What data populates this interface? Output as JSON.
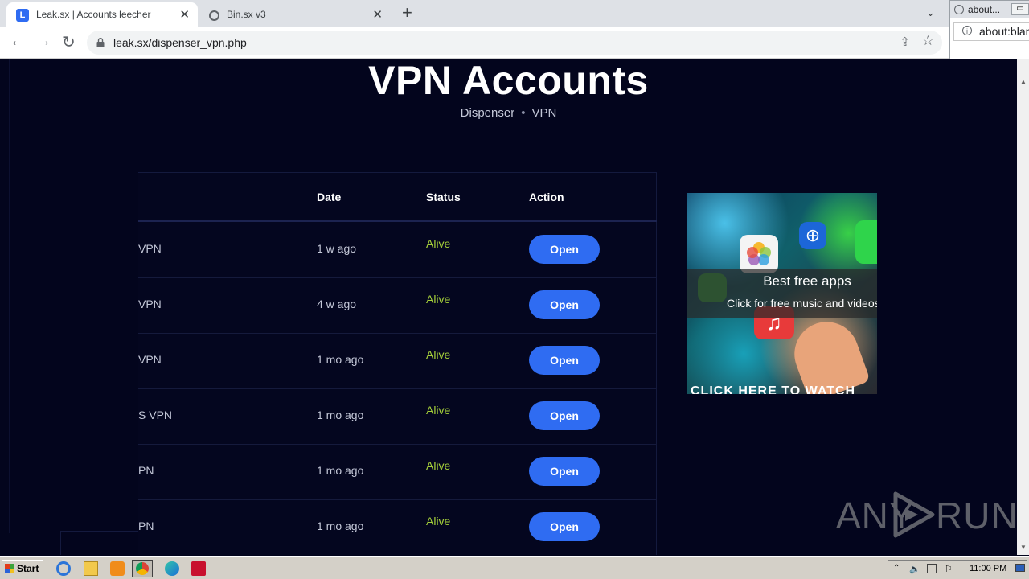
{
  "browser": {
    "tabs": [
      {
        "title": "Leak.sx | Accounts leecher",
        "active": true
      },
      {
        "title": "Bin.sx v3",
        "active": false
      }
    ],
    "url": "leak.sx/dispenser_vpn.php",
    "popup": {
      "tab_title": "about...",
      "url": "about:blank"
    }
  },
  "page": {
    "title": "VPN Accounts",
    "breadcrumb": [
      "Dispenser",
      "VPN"
    ],
    "table": {
      "headers": {
        "date": "Date",
        "status": "Status",
        "action": "Action"
      },
      "rows": [
        {
          "name": "VPN",
          "date": "1 w ago",
          "status": "Alive",
          "action": "Open"
        },
        {
          "name": "VPN",
          "date": "4 w ago",
          "status": "Alive",
          "action": "Open"
        },
        {
          "name": "VPN",
          "date": "1 mo ago",
          "status": "Alive",
          "action": "Open"
        },
        {
          "name": "S VPN",
          "date": "1 mo ago",
          "status": "Alive",
          "action": "Open"
        },
        {
          "name": "PN",
          "date": "1 mo ago",
          "status": "Alive",
          "action": "Open"
        },
        {
          "name": "PN",
          "date": "1 mo ago",
          "status": "Alive",
          "action": "Open"
        }
      ]
    },
    "ad": {
      "title": "Best free apps",
      "subtitle": "Click for free music and videos",
      "cta": "CLICK HERE TO WATCH"
    },
    "watermark": {
      "left": "ANY",
      "right": "RUN"
    }
  },
  "colors": {
    "page_bg": "#03051d",
    "status_alive": "#a6d13a",
    "button_blue": "#2f6cf2"
  },
  "taskbar": {
    "start_label": "Start",
    "clock": "11:00 PM",
    "icons": [
      "ie-icon",
      "folder-icon",
      "media-player-icon",
      "chrome-icon",
      "edge-icon",
      "app-icon"
    ]
  }
}
